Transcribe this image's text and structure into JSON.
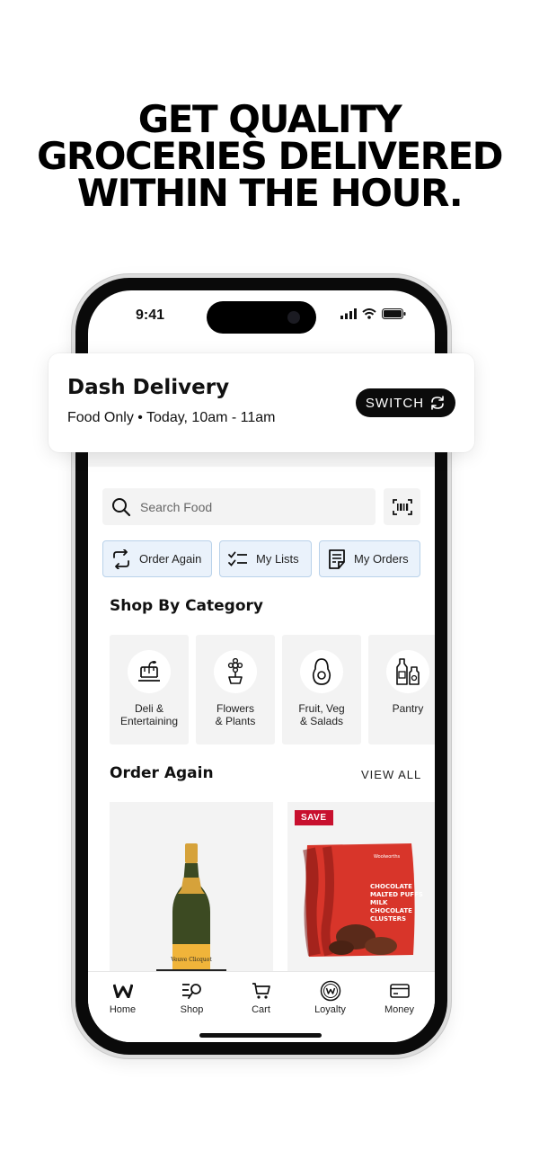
{
  "headline": {
    "lines": [
      "GET QUALITY",
      "GROCERIES DELIVERED",
      "WITHIN THE HOUR."
    ]
  },
  "status_bar": {
    "time": "9:41"
  },
  "delivery": {
    "title": "Dash Delivery",
    "subtitle": "Food Only • Today, 10am - 11am",
    "switch_label": "SWITCH"
  },
  "search": {
    "placeholder": "Search Food"
  },
  "quick_actions": [
    {
      "label": "Order Again",
      "icon": "reorder-icon"
    },
    {
      "label": "My Lists",
      "icon": "checklist-icon"
    },
    {
      "label": "My Orders",
      "icon": "receipt-icon"
    }
  ],
  "categories": {
    "title": "Shop By Category",
    "items": [
      {
        "label": "Deli &\nEntertaining",
        "icon": "deli-icon"
      },
      {
        "label": "Flowers\n& Plants",
        "icon": "flower-icon"
      },
      {
        "label": "Fruit, Veg\n& Salads",
        "icon": "avocado-icon"
      },
      {
        "label": "Pantry",
        "icon": "bottles-icon"
      }
    ]
  },
  "order_again": {
    "title": "Order Again",
    "view_all": "VIEW ALL",
    "products": [
      {
        "name": "champagne-bottle",
        "badge": ""
      },
      {
        "name": "chocolate-bag",
        "badge": "SAVE",
        "bag_text": "CHOCOLATE MALTED PUFFS MILK CHOCOLATE CLUSTERS",
        "brand_text": "Woolworths"
      }
    ]
  },
  "bottom_nav": [
    {
      "label": "Home",
      "icon": "home-w-icon"
    },
    {
      "label": "Shop",
      "icon": "shop-search-icon"
    },
    {
      "label": "Cart",
      "icon": "cart-icon"
    },
    {
      "label": "Loyalty",
      "icon": "loyalty-icon"
    },
    {
      "label": "Money",
      "icon": "card-icon"
    }
  ],
  "colors": {
    "accent_chip_bg": "#eaf2fb",
    "accent_chip_border": "#b9d2ea",
    "save_red": "#c8102e"
  }
}
